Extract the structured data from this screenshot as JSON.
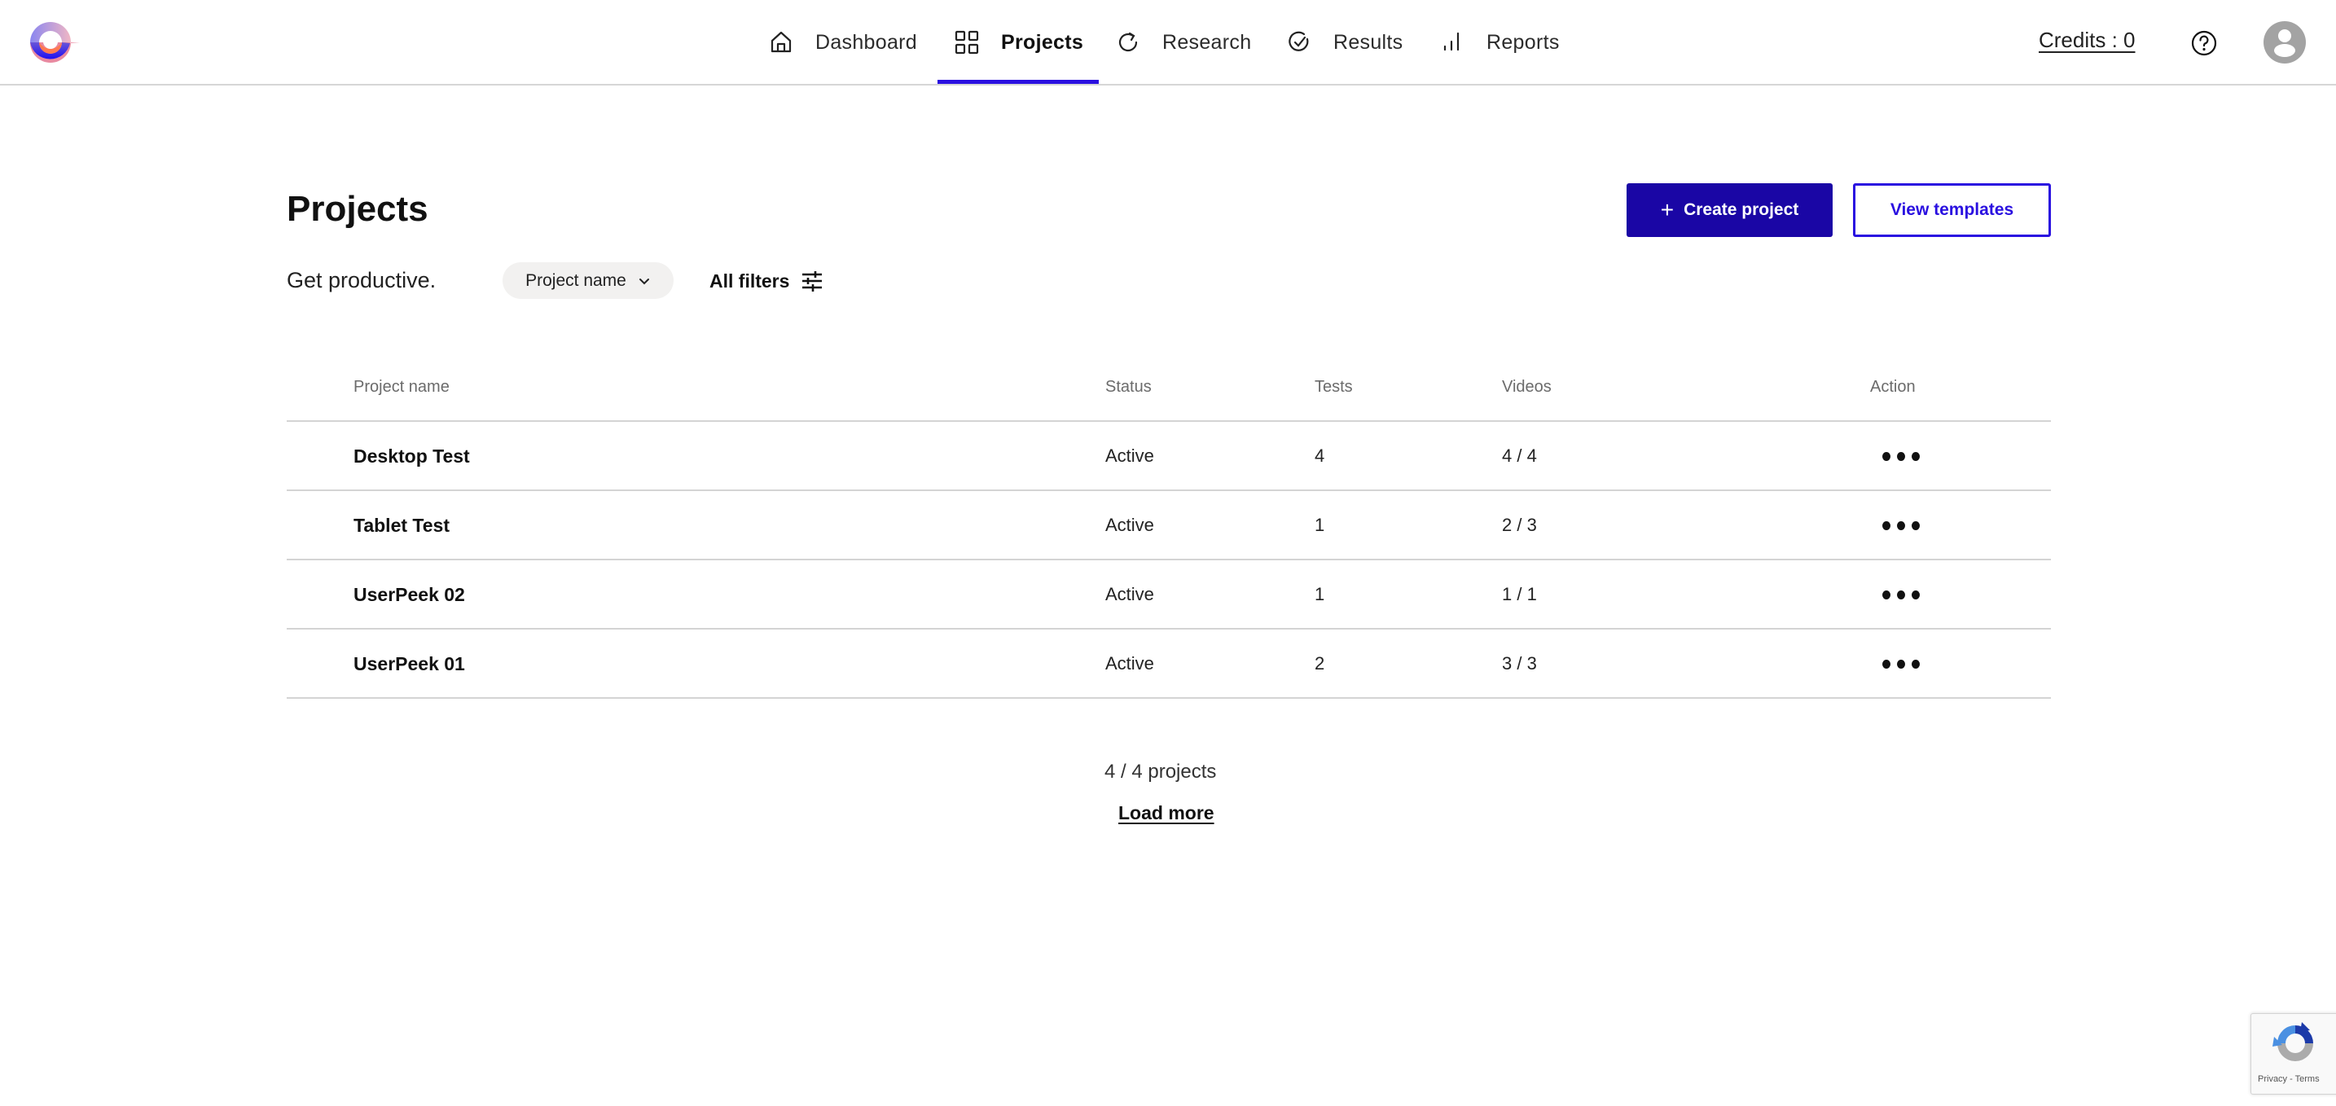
{
  "header": {
    "logo_name": "brand-logo",
    "nav": [
      {
        "label": "Dashboard",
        "icon": "home-icon",
        "active": false
      },
      {
        "label": "Projects",
        "icon": "grid-icon",
        "active": true
      },
      {
        "label": "Research",
        "icon": "refresh-icon",
        "active": false
      },
      {
        "label": "Results",
        "icon": "check-circle-icon",
        "active": false
      },
      {
        "label": "Reports",
        "icon": "bar-chart-icon",
        "active": false
      }
    ],
    "credits": "Credits : 0",
    "help_icon": "help-icon",
    "avatar_icon": "user-avatar-icon"
  },
  "page": {
    "title": "Projects",
    "subtitle": "Get productive.",
    "create_button": "Create project",
    "templates_button": "View templates",
    "sort_selected": "Project name",
    "all_filters": "All filters"
  },
  "table": {
    "columns": [
      "Project name",
      "Status",
      "Tests",
      "Videos",
      "Action"
    ],
    "rows": [
      {
        "name": "Desktop Test",
        "status": "Active",
        "tests": "4",
        "videos": "4 / 4"
      },
      {
        "name": "Tablet Test",
        "status": "Active",
        "tests": "1",
        "videos": "2 / 3"
      },
      {
        "name": "UserPeek 02",
        "status": "Active",
        "tests": "1",
        "videos": "1 / 1"
      },
      {
        "name": "UserPeek 01",
        "status": "Active",
        "tests": "2",
        "videos": "3 / 3"
      }
    ]
  },
  "footer": {
    "count": "4 / 4 projects",
    "load_more": "Load more"
  },
  "recaptcha": {
    "text": "Privacy - Terms"
  },
  "colors": {
    "accent": "#2a10e0",
    "primary_button": "#1a06a5",
    "pill_bg": "#f2f1f0",
    "divider": "#d4d4d4"
  }
}
